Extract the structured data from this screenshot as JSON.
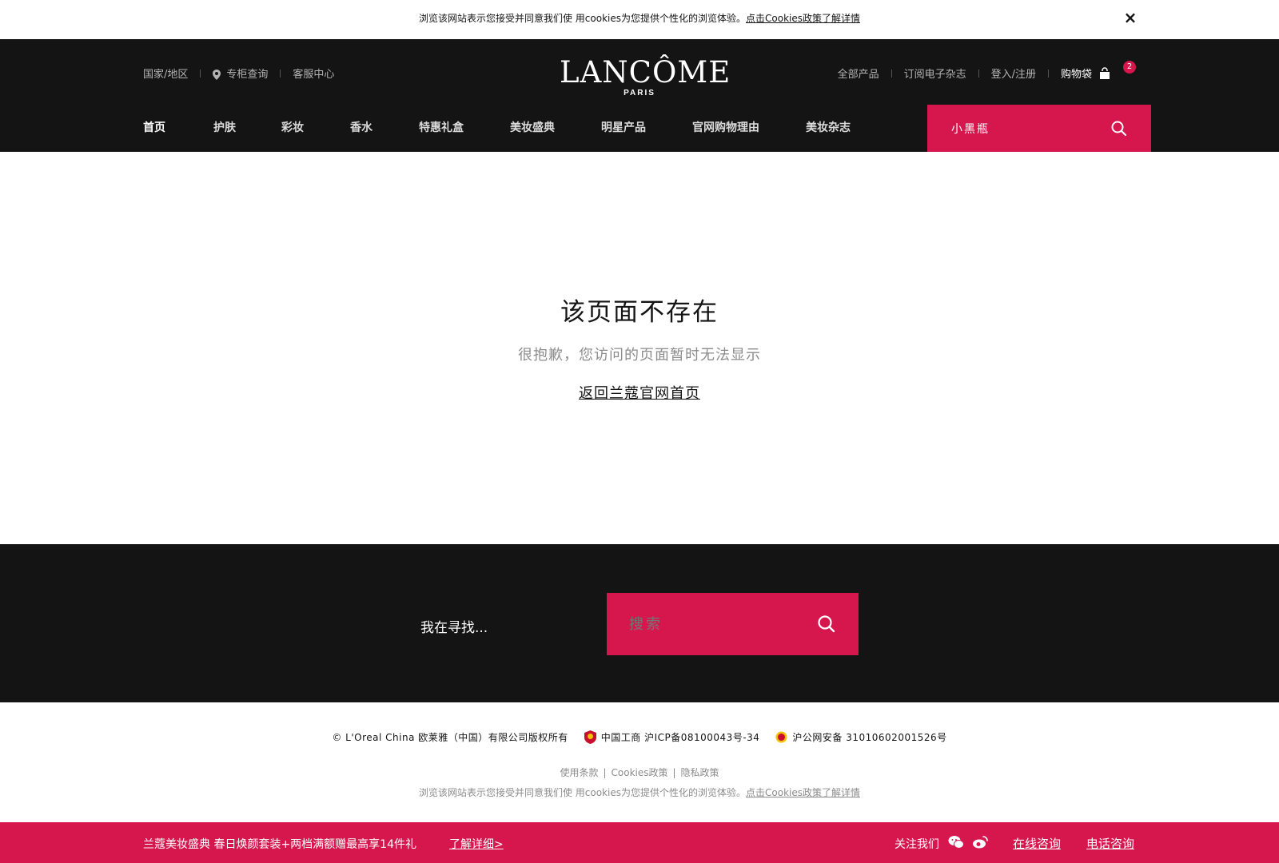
{
  "colors": {
    "brand_pink": "#d6174e",
    "header_black": "#141414",
    "muted_gray": "#8c8c8c"
  },
  "cookie_bar": {
    "text": "浏览该网站表示您接受并同意我们使 用cookies为您提供个性化的浏览体验。",
    "link": "点击Cookies政策了解详情",
    "close_icon": "×"
  },
  "header": {
    "util_left": {
      "region": "国家/地区",
      "store": "专柜查询",
      "service": "客服中心"
    },
    "logo": {
      "main": "LANCÔME",
      "sub": "PARIS"
    },
    "util_right": {
      "all_products": "全部产品",
      "newsletter": "订阅电子杂志",
      "login": "登入/注册",
      "bag": "购物袋",
      "bag_count": "2"
    },
    "nav": [
      "首页",
      "护肤",
      "彩妆",
      "香水",
      "特惠礼盒",
      "美妆盛典",
      "明星产品",
      "官网购物理由",
      "美妆杂志"
    ],
    "search": {
      "value": "小黑瓶"
    }
  },
  "main": {
    "title": "该页面不存在",
    "subtitle": "很抱歉，您访问的页面暂时无法显示",
    "back_link": "返回兰蔻官网首页"
  },
  "footer_search": {
    "label": "我在寻找...",
    "placeholder": "搜索"
  },
  "legal": {
    "copyright": "© L'Oreal China 欧莱雅（中国）有限公司版权所有",
    "icp": "中国工商 沪ICP备08100043号-34",
    "police": "沪公网安备 31010602001526号",
    "links": [
      "使用条款",
      "Cookies政策",
      "隐私政策"
    ],
    "cookie_text": "浏览该网站表示您接受并同意我们使 用cookies为您提供个性化的浏览体验。",
    "cookie_link": "点击Cookies政策了解详情"
  },
  "promo": {
    "text": "兰蔻美妆盛典 春日焕颜套装+两档满额赠最高享14件礼",
    "more": "了解详细>",
    "follow": "关注我们",
    "online": "在线咨询",
    "phone": "电话咨询"
  },
  "icons": [
    "close-icon",
    "location-pin-icon",
    "shopping-bag-icon",
    "search-icon",
    "emblem-icon",
    "police-badge-icon",
    "wechat-icon",
    "weibo-icon"
  ]
}
